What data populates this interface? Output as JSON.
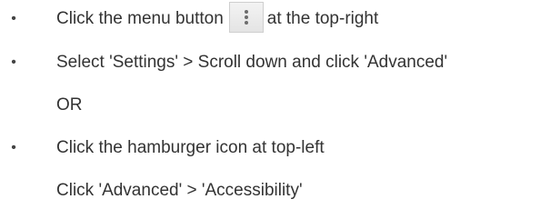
{
  "steps": {
    "item1": {
      "bullet": "•",
      "before": "Click the menu button",
      "after": "at the top-right",
      "icon": "vertical-dots-menu-icon"
    },
    "item2": {
      "bullet": "•",
      "text": "Select 'Settings' > Scroll down and click 'Advanced'"
    },
    "or_text": "OR",
    "item3": {
      "bullet": "•",
      "text": "Click the hamburger icon at top-left"
    },
    "item3_sub": "Click 'Advanced' > 'Accessibility'"
  }
}
